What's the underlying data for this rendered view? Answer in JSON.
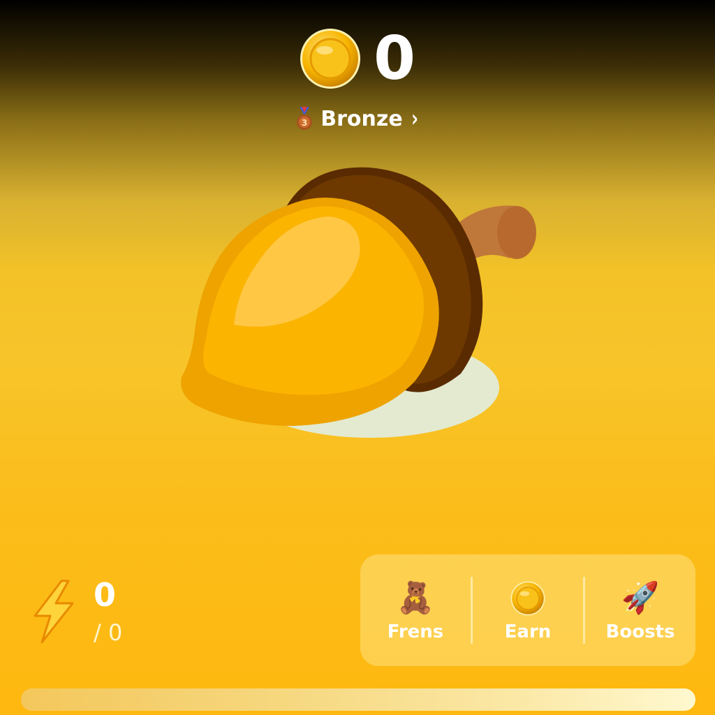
{
  "balance": {
    "value": "0",
    "coin_icon": "gold-coin-icon"
  },
  "league": {
    "label": "Bronze",
    "medal_icon": "bronze-medal-icon",
    "arrow_icon": "chevron-right-icon"
  },
  "tap_target": {
    "icon": "acorn-icon"
  },
  "energy": {
    "value": "0",
    "max": "/ 0",
    "icon": "lightning-icon",
    "progress_fraction": 0
  },
  "nav": {
    "items": [
      {
        "label": "Frens",
        "icon": "teddy-bear-icon"
      },
      {
        "label": "Earn",
        "icon": "gold-coin-icon"
      },
      {
        "label": "Boosts",
        "icon": "rocket-icon"
      }
    ]
  },
  "colors": {
    "coin": "#f5b800",
    "acorn_body": "#fbb400",
    "acorn_cap": "#6b3500",
    "accent": "#ffb80f"
  }
}
